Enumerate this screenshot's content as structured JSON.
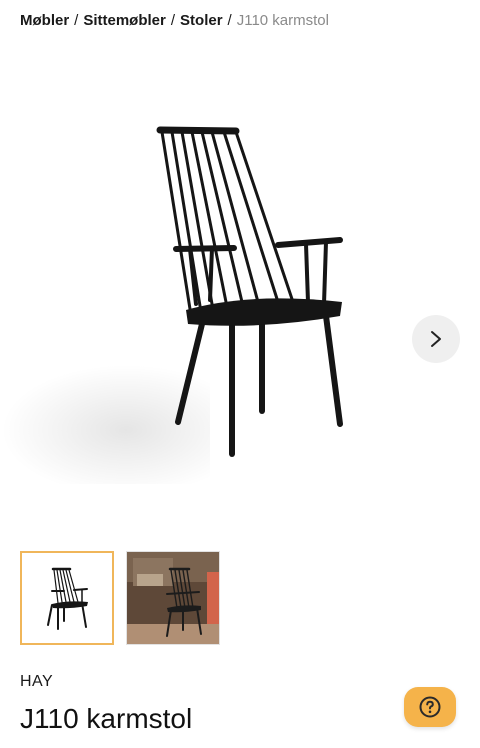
{
  "breadcrumb": {
    "items": [
      "Møbler",
      "Sittemøbler",
      "Stoler"
    ],
    "separator": "/",
    "current": "J110 karmstol"
  },
  "gallery": {
    "next_icon": "chevron-right-icon",
    "thumbnails": [
      {
        "description": "chair-product-shot",
        "selected": true
      },
      {
        "description": "chair-in-room",
        "selected": false
      }
    ],
    "selected_border_color": "#f0b65a"
  },
  "product": {
    "brand": "HAY",
    "title": "J110 karmstol"
  },
  "help": {
    "icon": "question-circle-icon",
    "color": "#f5b34a"
  }
}
